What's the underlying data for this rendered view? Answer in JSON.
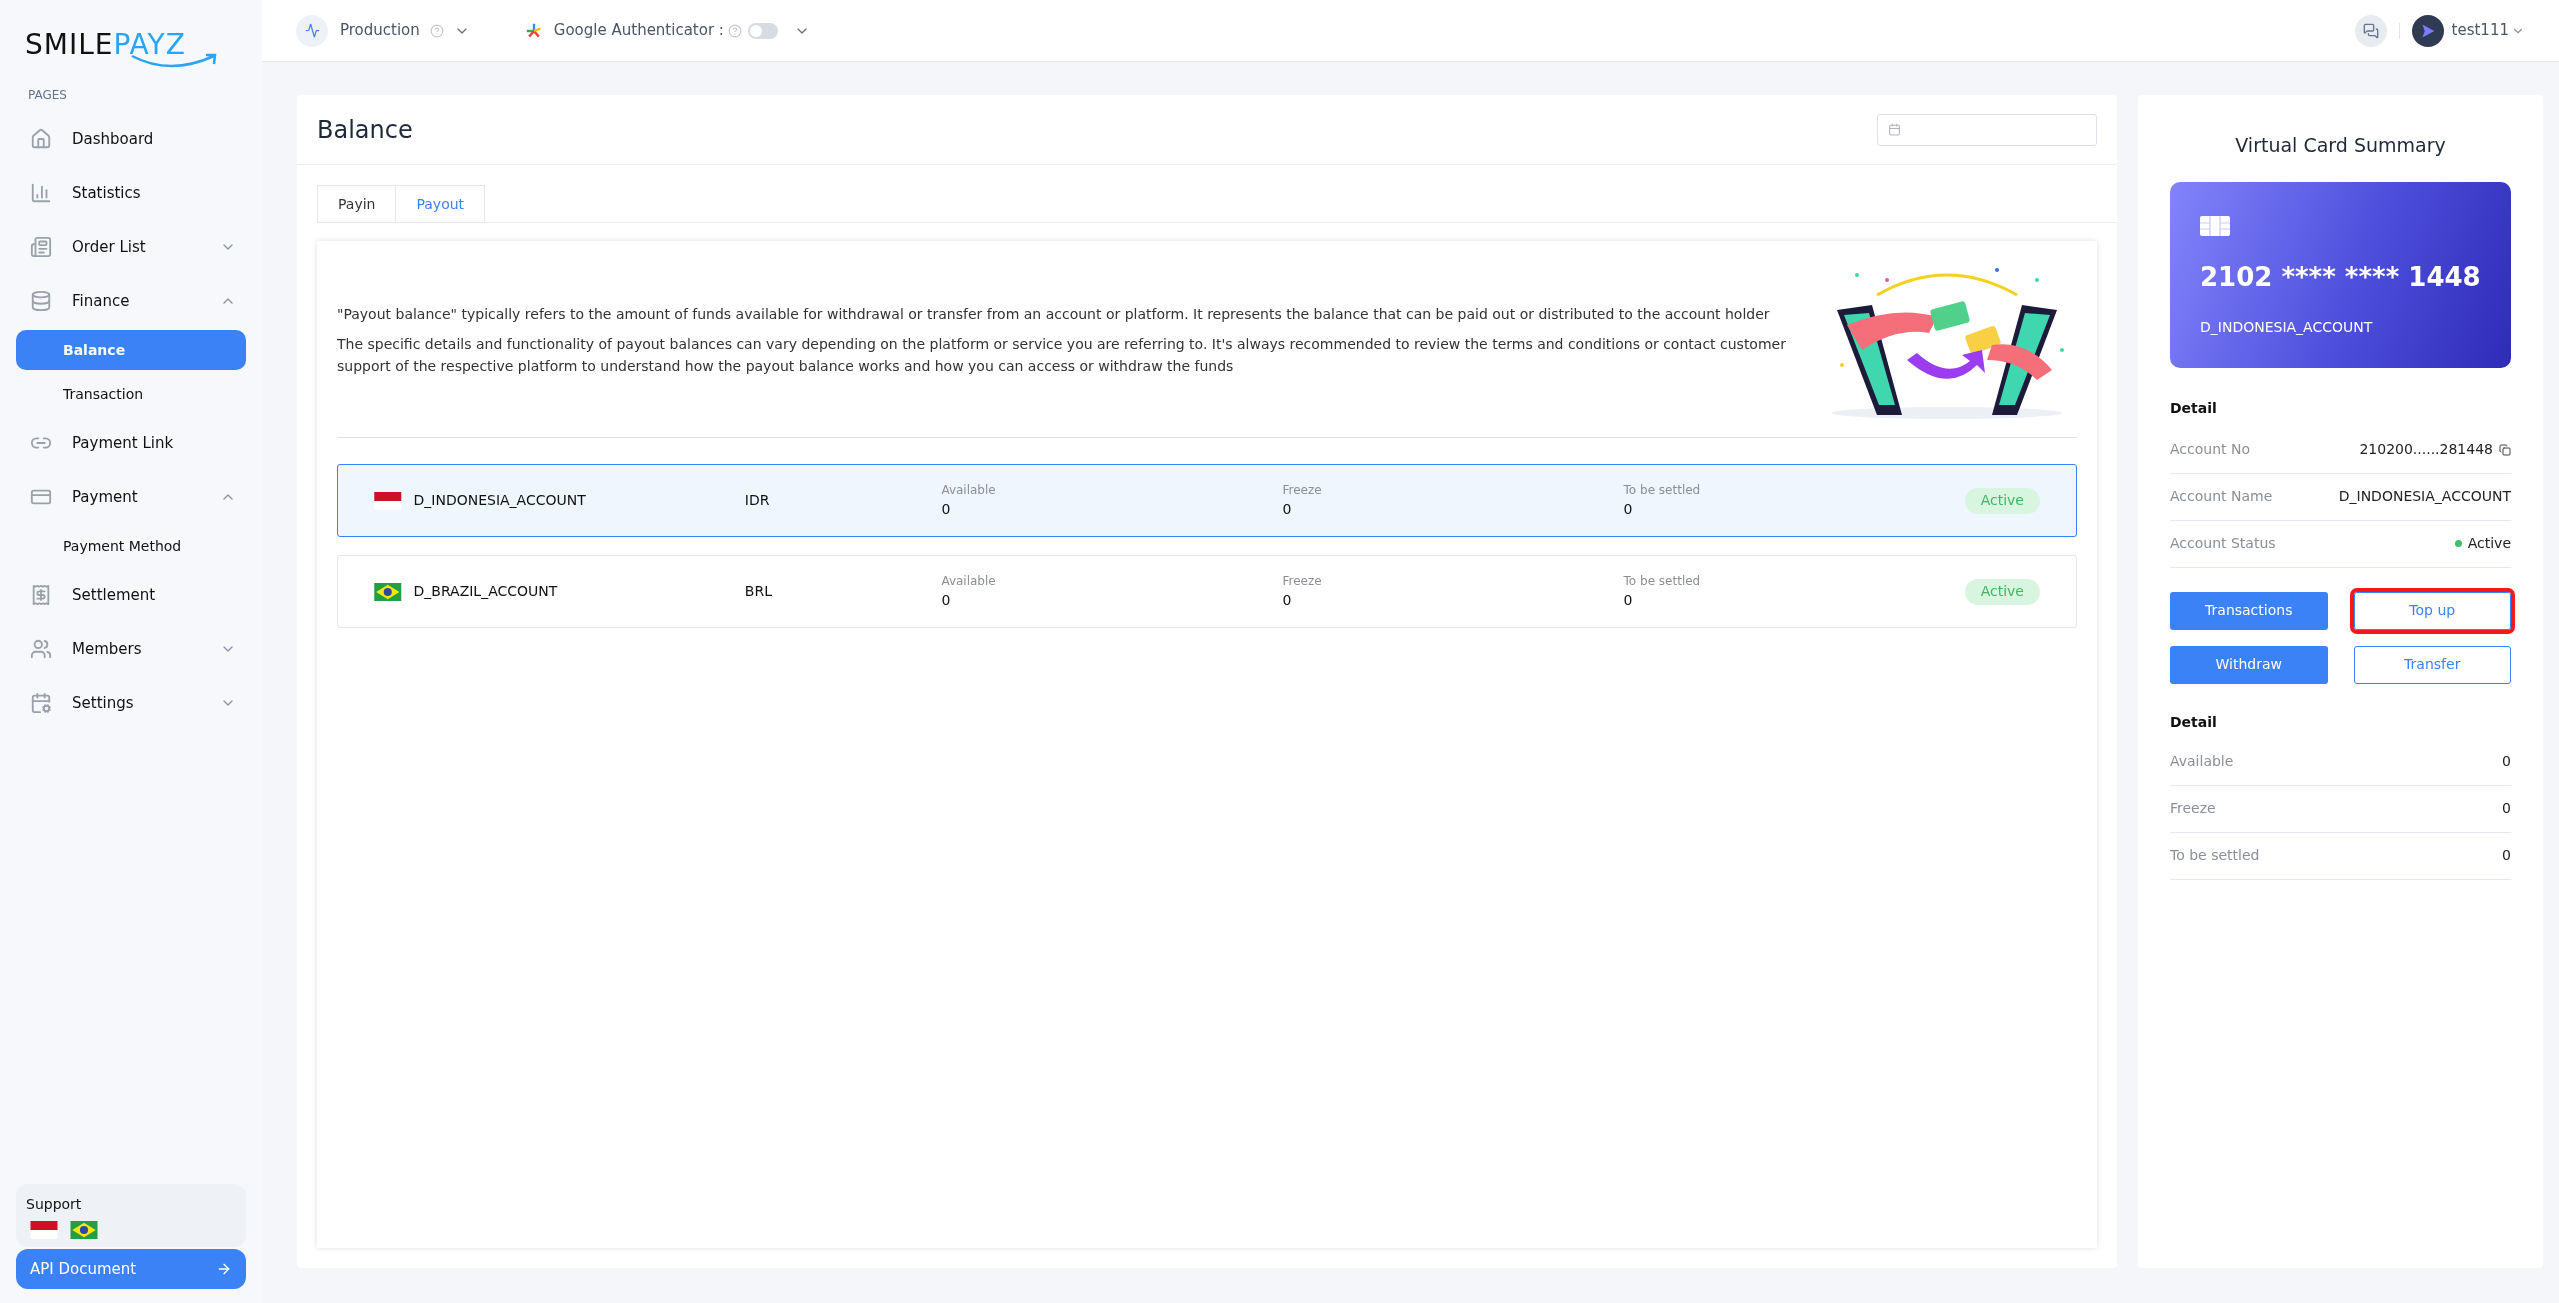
{
  "brand": {
    "part_1": "SMILE",
    "part_2": "PAYZ"
  },
  "sidebar": {
    "section_label": "PAGES",
    "items": [
      {
        "label": "Dashboard",
        "selected": false
      },
      {
        "label": "Statistics",
        "selected": false
      },
      {
        "label": "Order List",
        "selected": false,
        "expanded": false
      },
      {
        "label": "Finance",
        "selected": false,
        "expanded": true,
        "children": [
          {
            "label": "Balance",
            "selected": true
          },
          {
            "label": "Transaction",
            "selected": false
          }
        ]
      },
      {
        "label": "Payment Link",
        "selected": false
      },
      {
        "label": "Payment",
        "selected": false,
        "expanded": true,
        "children": [
          {
            "label": "Payment Method",
            "selected": false
          }
        ]
      },
      {
        "label": "Settlement",
        "selected": false
      },
      {
        "label": "Members",
        "selected": false,
        "expanded": false
      },
      {
        "label": "Settings",
        "selected": false,
        "expanded": false
      }
    ],
    "support": {
      "title": "Support",
      "flags": [
        {
          "kind": "indonesia"
        },
        {
          "kind": "brazil"
        }
      ]
    },
    "api_button": "API Document"
  },
  "topbar": {
    "environment": "Production",
    "authenticator": {
      "label": "Google Authenticator :",
      "on": false
    },
    "user": "test111"
  },
  "page": {
    "title": "Balance",
    "tabs": [
      {
        "label": "Payin",
        "selected": false
      },
      {
        "label": "Payout",
        "selected": true
      }
    ],
    "intro": [
      "\"Payout balance\" typically refers to the amount of funds available for withdrawal or transfer from an account or platform. It represents the balance that can be paid out or distributed to the account holder",
      "The specific details and functionality of payout balances can vary depending on the platform or service you are referring to. It's always recommended to review the terms and conditions or contact customer support of the respective platform to understand how the payout balance works and how you can access or withdraw the funds"
    ],
    "accounts": [
      {
        "kind": "indonesia",
        "name": "D_INDONESIA_ACCOUNT",
        "currency": "IDR",
        "selected": true,
        "stats": [
          {
            "label": "Available",
            "value": "0"
          },
          {
            "label": "Freeze",
            "value": "0"
          },
          {
            "label": "To be settled",
            "value": "0"
          }
        ],
        "status": "Active"
      },
      {
        "kind": "brazil",
        "name": "D_BRAZIL_ACCOUNT",
        "currency": "BRL",
        "selected": false,
        "stats": [
          {
            "label": "Available",
            "value": "0"
          },
          {
            "label": "Freeze",
            "value": "0"
          },
          {
            "label": "To be settled",
            "value": "0"
          }
        ],
        "status": "Active"
      }
    ]
  },
  "summary": {
    "title": "Virtual Card Summary",
    "card": {
      "number": "2102 **** **** 1448",
      "holder": "D_INDONESIA_ACCOUNT"
    },
    "detail_title": "Detail",
    "details": [
      {
        "label": "Account No",
        "value": "210200......281448",
        "kind": "copy"
      },
      {
        "label": "Account Name",
        "value": "D_INDONESIA_ACCOUNT",
        "kind": "text"
      },
      {
        "label": "Account Status",
        "value": "Active",
        "kind": "status"
      }
    ],
    "buttons": [
      {
        "label": "Transactions",
        "kind": "filled",
        "highlighted": false
      },
      {
        "label": "Top up",
        "kind": "outline",
        "highlighted": true
      },
      {
        "label": "Withdraw",
        "kind": "filled",
        "highlighted": false
      },
      {
        "label": "Transfer",
        "kind": "outline",
        "highlighted": false
      }
    ],
    "balance_title": "Detail",
    "balances": [
      {
        "label": "Available",
        "value": "0"
      },
      {
        "label": "Freeze",
        "value": "0"
      },
      {
        "label": "To be settled",
        "value": "0"
      }
    ]
  }
}
